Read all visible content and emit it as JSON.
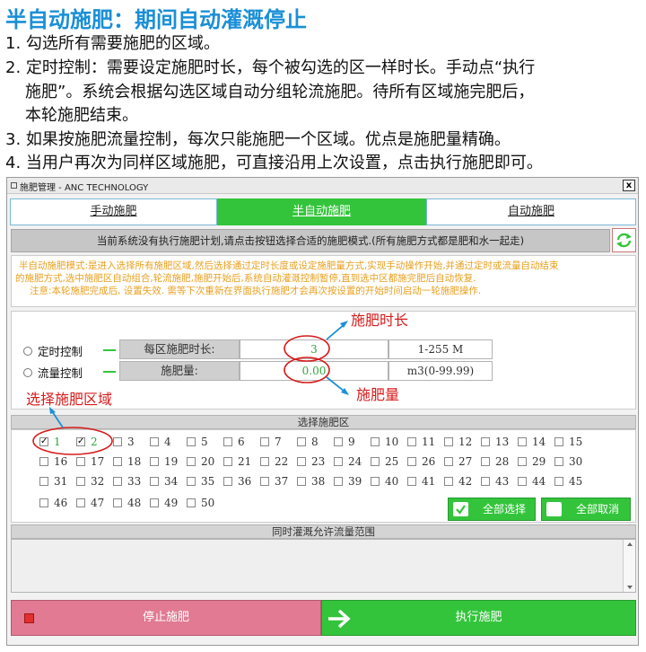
{
  "heading": "半自动施肥：期间自动灌溉停止",
  "steps": [
    "1. 勾选所有需要施肥的区域。",
    "2. 定时控制：需要设定施肥时长，每个被勾选的区一样时长。手动点“执行",
    "施肥”。系统会根据勾选区域自动分组轮流施肥。待所有区域施完肥后，",
    "本轮施肥结束。",
    "3. 如果按施肥流量控制，每次只能施肥一个区域。优点是施肥量精确。",
    "4. 当用户再次为同样区域施肥，可直接沿用上次设置，点击执行施肥即可。"
  ],
  "window": {
    "title": "施肥管理 - ANC TECHNOLOGY",
    "close": "x"
  },
  "tabs": [
    {
      "label": "手动施肥",
      "active": false
    },
    {
      "label": "半自动施肥",
      "active": true
    },
    {
      "label": "自动施肥",
      "active": false
    }
  ],
  "notice": "当前系统没有执行施肥计划,请点击按钮选择合适的施肥模式.(所有施肥方式都是肥和水一起走)",
  "description": [
    "半自动施肥模式:是进入选择所有施肥区域,然后选择通过定时长度或设定施肥量方式,实现手动操作开始,并通过定时或流量自动结束",
    "的施肥方式,选中施肥区自动组合,轮流施肥,施肥开始后,系统自动灌溉控制暂停,直到选中区都施完肥后自动恢复.",
    "注意:本轮施肥完成后, 设置失效. 需等下次重新在界面执行施肥才会再次按设置的开始时间启动一轮施肥操作."
  ],
  "modes": {
    "timed": {
      "label": "定时控制",
      "field_label": "每区施肥时长:",
      "value": "3",
      "range": "1-255 M"
    },
    "flow": {
      "label": "流量控制",
      "field_label": "施肥量:",
      "value": "0.00",
      "range": "m3(0-99.99)"
    }
  },
  "annotations": {
    "duration": "施肥时长",
    "amount": "施肥量",
    "zones": "选择施肥区域"
  },
  "zones": {
    "header": "选择施肥区",
    "rows": [
      [
        {
          "n": "1",
          "checked": true
        },
        {
          "n": "2",
          "checked": true
        },
        {
          "n": "3",
          "checked": false
        },
        {
          "n": "4",
          "checked": false
        },
        {
          "n": "5",
          "checked": false
        },
        {
          "n": "6",
          "checked": false
        },
        {
          "n": "7",
          "checked": false
        },
        {
          "n": "8",
          "checked": false
        },
        {
          "n": "9",
          "checked": false
        },
        {
          "n": "10",
          "checked": false
        },
        {
          "n": "11",
          "checked": false
        },
        {
          "n": "12",
          "checked": false
        },
        {
          "n": "13",
          "checked": false
        },
        {
          "n": "14",
          "checked": false
        },
        {
          "n": "15",
          "checked": false
        }
      ],
      [
        {
          "n": "16",
          "checked": false
        },
        {
          "n": "17",
          "checked": false
        },
        {
          "n": "18",
          "checked": false
        },
        {
          "n": "19",
          "checked": false
        },
        {
          "n": "20",
          "checked": false
        },
        {
          "n": "21",
          "checked": false
        },
        {
          "n": "22",
          "checked": false
        },
        {
          "n": "23",
          "checked": false
        },
        {
          "n": "24",
          "checked": false
        },
        {
          "n": "25",
          "checked": false
        },
        {
          "n": "26",
          "checked": false
        },
        {
          "n": "27",
          "checked": false
        },
        {
          "n": "28",
          "checked": false
        },
        {
          "n": "29",
          "checked": false
        },
        {
          "n": "30",
          "checked": false
        }
      ],
      [
        {
          "n": "31",
          "checked": false
        },
        {
          "n": "32",
          "checked": false
        },
        {
          "n": "33",
          "checked": false
        },
        {
          "n": "34",
          "checked": false
        },
        {
          "n": "35",
          "checked": false
        },
        {
          "n": "36",
          "checked": false
        },
        {
          "n": "37",
          "checked": false
        },
        {
          "n": "38",
          "checked": false
        },
        {
          "n": "39",
          "checked": false
        },
        {
          "n": "40",
          "checked": false
        },
        {
          "n": "41",
          "checked": false
        },
        {
          "n": "42",
          "checked": false
        },
        {
          "n": "43",
          "checked": false
        },
        {
          "n": "44",
          "checked": false
        },
        {
          "n": "45",
          "checked": false
        }
      ],
      [
        {
          "n": "46",
          "checked": false
        },
        {
          "n": "47",
          "checked": false
        },
        {
          "n": "48",
          "checked": false
        },
        {
          "n": "49",
          "checked": false
        },
        {
          "n": "50",
          "checked": false
        }
      ]
    ],
    "select_all": "全部选择",
    "deselect_all": "全部取消"
  },
  "flow_header": "同时灌溉允许流量范围",
  "buttons": {
    "stop": "停止施肥",
    "run": "执行施肥"
  },
  "colors": {
    "heading": "#1a8fd6",
    "green": "#33c43b",
    "stop": "#e17a92",
    "annotation": "#d81b1b",
    "description": "#e8a020"
  }
}
